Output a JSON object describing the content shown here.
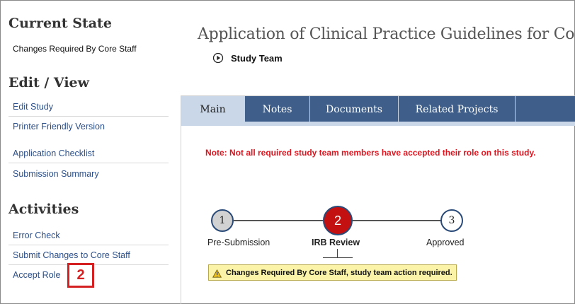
{
  "sidebar": {
    "current_state_heading": "Current State",
    "current_state_value": "Changes Required By Core Staff",
    "edit_view_heading": "Edit / View",
    "edit_view_links": [
      {
        "label": "Edit Study"
      },
      {
        "label": "Printer Friendly Version"
      },
      {
        "label": "Application Checklist"
      },
      {
        "label": "Submission Summary"
      }
    ],
    "activities_heading": "Activities",
    "activities_links": [
      {
        "label": "Error Check"
      },
      {
        "label": "Submit Changes to Core Staff"
      },
      {
        "label": "Accept Role"
      }
    ]
  },
  "callout": {
    "number": "2",
    "color": "#d42020"
  },
  "header": {
    "title": "Application of Clinical Practice Guidelines for Com",
    "team_label": "Study Team",
    "team_icon": "play-circle-icon"
  },
  "tabs": [
    {
      "label": "Main",
      "active": true
    },
    {
      "label": "Notes"
    },
    {
      "label": "Documents"
    },
    {
      "label": "Related Projects"
    },
    {
      "label": ""
    }
  ],
  "note": "Note: Not all required study team members have accepted their role on this study.",
  "steps": [
    {
      "number": "1",
      "label": "Pre-Submission",
      "state": "done"
    },
    {
      "number": "2",
      "label": "IRB Review",
      "state": "current"
    },
    {
      "number": "3",
      "label": "Approved",
      "state": "future"
    }
  ],
  "warning": {
    "icon": "warning-triangle-icon",
    "text": "Changes Required By Core Staff, study team action required."
  },
  "colors": {
    "tab_bg": "#3f5f8a",
    "tab_active": "#c9d7e8",
    "note_red": "#e0141e",
    "current_step": "#c31010",
    "warning_bg": "#fbf3a8"
  }
}
